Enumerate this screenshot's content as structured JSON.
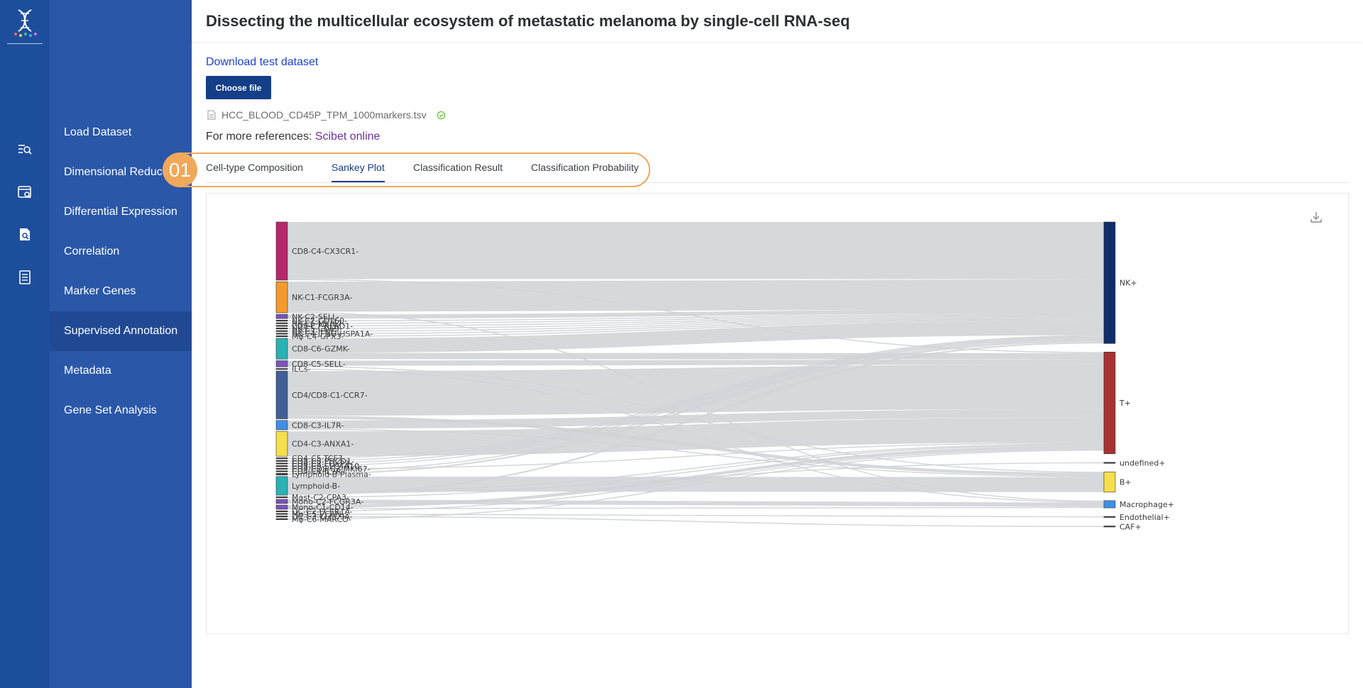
{
  "app": {
    "title": "Dissecting the multicellular ecosystem of metastatic melanoma by single-cell RNA-seq"
  },
  "rail": {
    "icons": [
      "dna-logo-icon",
      "search-list-icon",
      "window-search-icon",
      "document-search-icon",
      "notebook-icon"
    ]
  },
  "menu": {
    "items": [
      {
        "label": "Load Dataset",
        "active": false
      },
      {
        "label": "Dimensional Reduction",
        "active": false
      },
      {
        "label": "Differential Expression",
        "active": false
      },
      {
        "label": "Correlation",
        "active": false
      },
      {
        "label": "Marker Genes",
        "active": false
      },
      {
        "label": "Supervised Annotation",
        "active": true
      },
      {
        "label": "Metadata",
        "active": false
      },
      {
        "label": "Gene Set Analysis",
        "active": false
      }
    ]
  },
  "upload": {
    "download_label": "Download test dataset",
    "choose_label": "Choose file",
    "file_name": "HCC_BLOOD_CD45P_TPM_1000markers.tsv",
    "refs_prefix": "For more references: ",
    "refs_link": "Scibet online"
  },
  "tabs": {
    "badge": "01",
    "items": [
      {
        "label": "Cell-type Composition",
        "active": false
      },
      {
        "label": "Sankey Plot",
        "active": true
      },
      {
        "label": "Classification Result",
        "active": false
      },
      {
        "label": "Classification Probability",
        "active": false
      }
    ]
  },
  "chart_data": {
    "type": "sankey",
    "source_nodes": [
      {
        "name": "CD8-C4-CX3CR1-",
        "value": 56,
        "color": "#b5286a"
      },
      {
        "name": "NK-C1-FCGR3A-",
        "value": 30,
        "color": "#f39a2f"
      },
      {
        "name": "NK-C2-SELL-",
        "value": 4,
        "color": "#7a54b9"
      },
      {
        "name": "NK-C7-CD160-",
        "value": 1,
        "color": "#333333"
      },
      {
        "name": "NK-C6-MKI67-",
        "value": 1,
        "color": "#333333"
      },
      {
        "name": "CD8-C7-KLRD1-",
        "value": 1,
        "color": "#333333"
      },
      {
        "name": "NK-C5-CD69-",
        "value": 1,
        "color": "#333333"
      },
      {
        "name": "NK-C3-IFNG-",
        "value": 1,
        "color": "#333333"
      },
      {
        "name": "NK-C4-IFNG-HSPA1A-",
        "value": 1,
        "color": "#333333"
      },
      {
        "name": "Mφ-C4-GPX3-",
        "value": 1,
        "color": "#333333"
      },
      {
        "name": "CD8-C6-GZMK-",
        "value": 20,
        "color": "#2bb2b4"
      },
      {
        "name": "CD8-C5-SELL-",
        "value": 6,
        "color": "#7a54b9"
      },
      {
        "name": "ILCs-",
        "value": 1,
        "color": "#333333"
      },
      {
        "name": "CD4/CD8-C1-CCR7-",
        "value": 46,
        "color": "#415f95"
      },
      {
        "name": "CD8-C3-IL7R-",
        "value": 9,
        "color": "#3f8fe6"
      },
      {
        "name": "CD4-C3-ANXA1-",
        "value": 24,
        "color": "#f5df4d"
      },
      {
        "name": "CD4-C5-TCF7-",
        "value": 1,
        "color": "#333333"
      },
      {
        "name": "CD8-C8-PDCD1-",
        "value": 1,
        "color": "#333333"
      },
      {
        "name": "CD4-C7-FOXP3-",
        "value": 1,
        "color": "#333333"
      },
      {
        "name": "CD8-C9-SLC4A10-",
        "value": 1,
        "color": "#333333"
      },
      {
        "name": "CD4/CD8-C2-MKI67-",
        "value": 1,
        "color": "#333333"
      },
      {
        "name": "CD4-C4-IL7R-",
        "value": 1,
        "color": "#333333"
      },
      {
        "name": "Lymphoid-B-Plasma-",
        "value": 1.5,
        "color": "#333333"
      },
      {
        "name": "Lymphoid-B-",
        "value": 18,
        "color": "#2bb2b4"
      },
      {
        "name": "Mast-C2-CPA3-",
        "value": 1,
        "color": "#333333"
      },
      {
        "name": "Mono-C2-FCGR3A-",
        "value": 4,
        "color": "#7a54b9"
      },
      {
        "name": "Mono-C1-CD14-",
        "value": 4,
        "color": "#7a54b9"
      },
      {
        "name": "DC-C2-FCER1A-",
        "value": 1,
        "color": "#333333"
      },
      {
        "name": "Mφ-C5-VCAN-",
        "value": 1,
        "color": "#333333"
      },
      {
        "name": "DC-C3-CLEC9A-",
        "value": 1,
        "color": "#333333"
      },
      {
        "name": "Mφ-C6-MARCO-",
        "value": 1,
        "color": "#333333"
      }
    ],
    "target_nodes": [
      {
        "name": "NK+",
        "value": 117,
        "color": "#0f2d6b"
      },
      {
        "name": "T+",
        "value": 98,
        "color": "#a83232"
      },
      {
        "name": "undefined+",
        "value": 1,
        "color": "#333333"
      },
      {
        "name": "B+",
        "value": 19.5,
        "color": "#f5df4d"
      },
      {
        "name": "Macrophage+",
        "value": 7,
        "color": "#3f8fe6"
      },
      {
        "name": "Endothelial+",
        "value": 1,
        "color": "#333333"
      },
      {
        "name": "CAF+",
        "value": 1,
        "color": "#333333"
      }
    ],
    "links": [
      {
        "source": "CD8-C4-CX3CR1-",
        "target": "NK+",
        "value": 55
      },
      {
        "source": "CD8-C4-CX3CR1-",
        "target": "T+",
        "value": 1
      },
      {
        "source": "NK-C1-FCGR3A-",
        "target": "NK+",
        "value": 29
      },
      {
        "source": "NK-C1-FCGR3A-",
        "target": "Macrophage+",
        "value": 1
      },
      {
        "source": "NK-C2-SELL-",
        "target": "NK+",
        "value": 4
      },
      {
        "source": "NK-C7-CD160-",
        "target": "NK+",
        "value": 1
      },
      {
        "source": "NK-C6-MKI67-",
        "target": "NK+",
        "value": 1
      },
      {
        "source": "CD8-C7-KLRD1-",
        "target": "NK+",
        "value": 1
      },
      {
        "source": "NK-C5-CD69-",
        "target": "NK+",
        "value": 1
      },
      {
        "source": "NK-C3-IFNG-",
        "target": "NK+",
        "value": 1
      },
      {
        "source": "NK-C4-IFNG-HSPA1A-",
        "target": "NK+",
        "value": 1
      },
      {
        "source": "Mφ-C4-GPX3-",
        "target": "NK+",
        "value": 1
      },
      {
        "source": "CD8-C6-GZMK-",
        "target": "NK+",
        "value": 14
      },
      {
        "source": "CD8-C6-GZMK-",
        "target": "T+",
        "value": 6
      },
      {
        "source": "CD8-C5-SELL-",
        "target": "T+",
        "value": 5
      },
      {
        "source": "CD8-C5-SELL-",
        "target": "B+",
        "value": 1
      },
      {
        "source": "ILCs-",
        "target": "Macrophage+",
        "value": 1
      },
      {
        "source": "CD4/CD8-C1-CCR7-",
        "target": "T+",
        "value": 43
      },
      {
        "source": "CD4/CD8-C1-CCR7-",
        "target": "B+",
        "value": 3
      },
      {
        "source": "CD8-C3-IL7R-",
        "target": "T+",
        "value": 8
      },
      {
        "source": "CD8-C3-IL7R-",
        "target": "B+",
        "value": 1
      },
      {
        "source": "CD4-C3-ANXA1-",
        "target": "T+",
        "value": 24
      },
      {
        "source": "CD4-C5-TCF7-",
        "target": "NK+",
        "value": 1
      },
      {
        "source": "CD8-C8-PDCD1-",
        "target": "NK+",
        "value": 1
      },
      {
        "source": "CD4-C7-FOXP3-",
        "target": "NK+",
        "value": 1
      },
      {
        "source": "CD8-C9-SLC4A10-",
        "target": "NK+",
        "value": 1
      },
      {
        "source": "CD4/CD8-C2-MKI67-",
        "target": "T+",
        "value": 1
      },
      {
        "source": "CD4-C4-IL7R-",
        "target": "NK+",
        "value": 1
      },
      {
        "source": "Lymphoid-B-Plasma-",
        "target": "NK+",
        "value": 1.5
      },
      {
        "source": "Lymphoid-B-",
        "target": "B+",
        "value": 14.5
      },
      {
        "source": "Lymphoid-B-",
        "target": "T+",
        "value": 1
      },
      {
        "source": "Lymphoid-B-",
        "target": "undefined+",
        "value": 1
      },
      {
        "source": "Lymphoid-B-",
        "target": "NK+",
        "value": 1.5
      },
      {
        "source": "Mast-C2-CPA3-",
        "target": "T+",
        "value": 1
      },
      {
        "source": "Mono-C2-FCGR3A-",
        "target": "Macrophage+",
        "value": 4
      },
      {
        "source": "Mono-C1-CD14-",
        "target": "T+",
        "value": 3
      },
      {
        "source": "Mono-C1-CD14-",
        "target": "Macrophage+",
        "value": 1
      },
      {
        "source": "DC-C2-FCER1A-",
        "target": "T+",
        "value": 1
      },
      {
        "source": "Mφ-C5-VCAN-",
        "target": "Endothelial+",
        "value": 1
      },
      {
        "source": "DC-C3-CLEC9A-",
        "target": "CAF+",
        "value": 1
      },
      {
        "source": "Mφ-C6-MARCO-",
        "target": "T+",
        "value": 1
      }
    ],
    "link_color": "#cfd2d6"
  },
  "colors": {
    "rail": "#1d4e9c",
    "menu": "#2a57a8",
    "menu_active": "#214993",
    "accent": "#143e87",
    "highlight": "#f0a85a"
  },
  "toolbar": {
    "download_icon": "download-icon"
  }
}
